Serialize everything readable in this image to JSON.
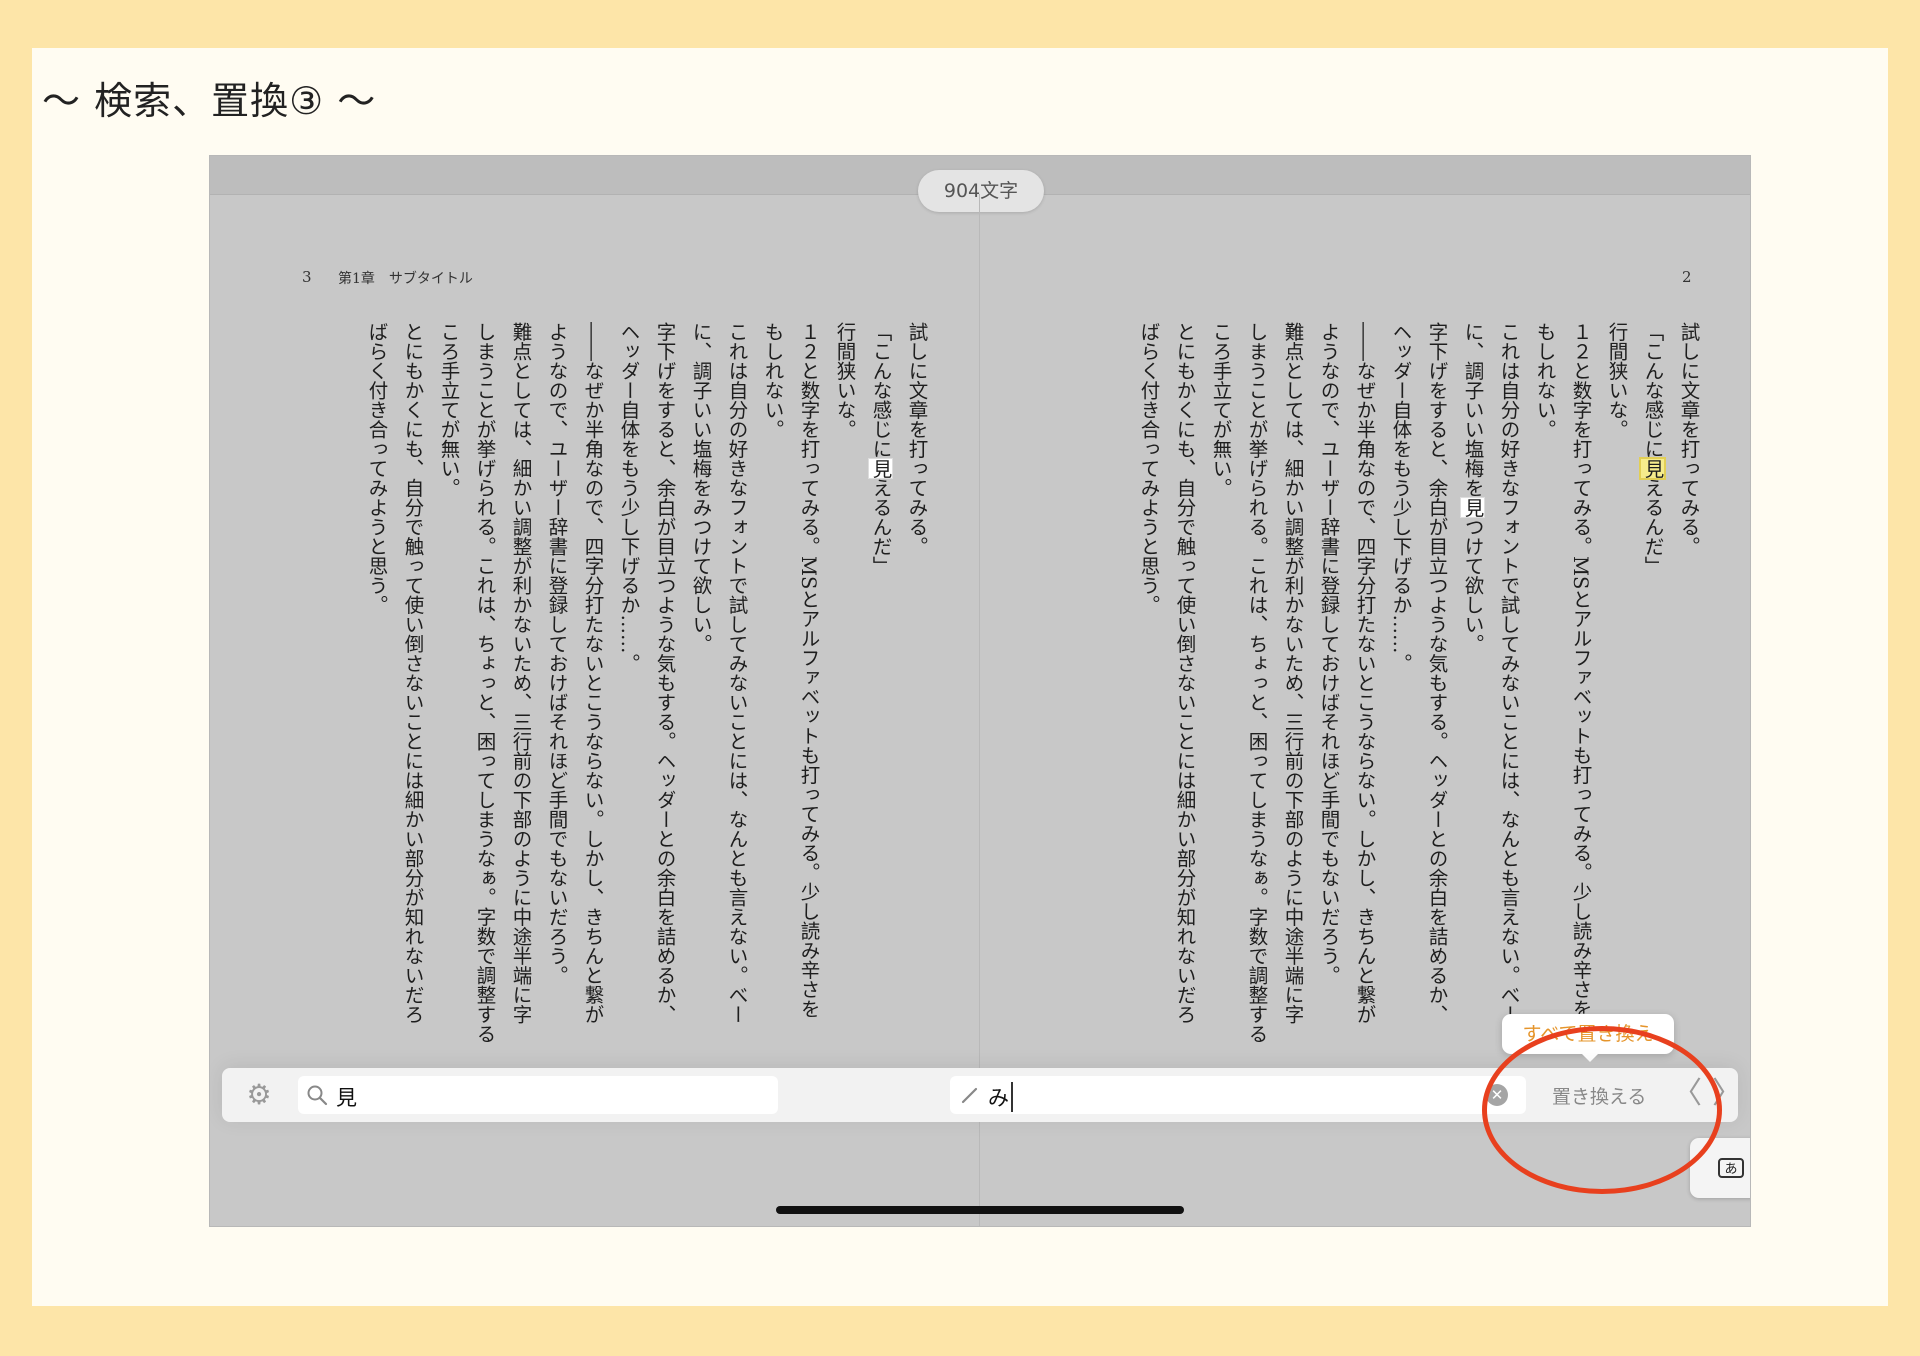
{
  "slide_title": "～ 検索、置換③ ～",
  "char_count": "904文字",
  "left_page": {
    "number": "3",
    "running_head": "第1章　サブタイトル",
    "lines": [
      "試しに文章を打ってみる。",
      "「こんな感じに",
      "行間狭いな。",
      "１２と数字を打ってみる。MSとアルファベットも打ってみる。少し読み辛さを",
      "もしれない。",
      "これは自分の好きなフォントで試してみないことには、なんとも言えない。べー",
      "に、調子いい塩梅をみつけて欲しい。",
      "字下げをすると、余白が目立つような気もする。ヘッダーとの余白を詰めるか、",
      "ヘッダー自体をもう少し下げるか……。",
      "――なぜか半角なので、四字分打たないとこうならない。しかし、きちんと繋が",
      "ようなので、ユーザー辞書に登録しておけばそれほど手間でもないだろう。",
      "難点としては、細かい調整が利かないため、三行前の下部のように中途半端に字",
      "しまうことが挙げられる。これは、ちょっと、困ってしまうなぁ。字数で調整する",
      "ころ手立てが無い。",
      "とにもかくにも、自分で触って使い倒さないことには細かい部分が知れないだろ",
      "ばらく付き合ってみようと思う。"
    ],
    "highlight_word": "見",
    "line2_rest": "えるんだ」"
  },
  "right_page": {
    "number": "2",
    "lines": [
      "試しに文章を打ってみる。",
      "「こんな感じに",
      "行間狭いな。",
      "１２と数字を打ってみる。MSとアルファベットも打ってみる。少し読み辛さを",
      "もしれない。",
      "これは自分の好きなフォントで試してみないことには、なんとも言えない。べー",
      "に、調子いい塩梅を",
      "字下げをすると、余白が目立つような気もする。ヘッダーとの余白を詰めるか、",
      "ヘッダー自体をもう少し下げるか……。",
      "――なぜか半角なので、四字分打たないとこうならない。しかし、きちんと繋が",
      "ようなので、ユーザー辞書に登録しておけばそれほど手間でもないだろう。",
      "難点としては、細かい調整が利かないため、三行前の下部のように中途半端に字",
      "しまうことが挙げられる。これは、ちょっと、困ってしまうなぁ。字数で調整する",
      "ころ手立てが無い。",
      "とにもかくにも、自分で触って使い倒さないことには細かい部分が知れないだろ",
      "ばらく付き合ってみようと思う。"
    ],
    "highlight_word": "見",
    "line2_rest": "えるんだ」",
    "line7_rest": "つけて欲しい。"
  },
  "search": {
    "query": "見",
    "replace_value": "み",
    "replace_button": "置き換える",
    "replace_all_button": "すべて置き換え",
    "prev_symbol": "〈",
    "next_symbol": "〉"
  },
  "keyboard_key_label": "あ",
  "colors": {
    "annotation_circle": "#e8401e",
    "accent": "#e5942a",
    "highlight": "#f6ec8c"
  }
}
